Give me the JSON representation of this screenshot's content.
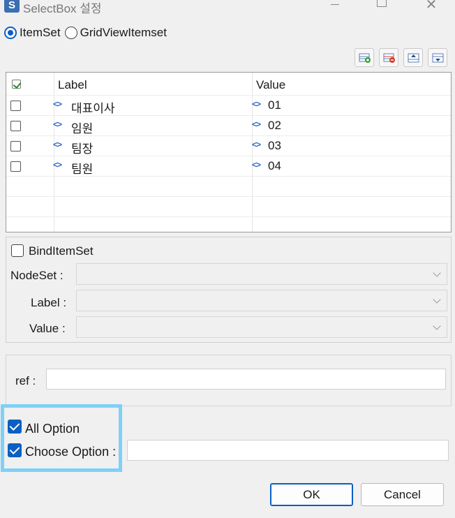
{
  "window": {
    "title": "SelectBox 설정",
    "app_icon_text": "S"
  },
  "mode": {
    "options": [
      {
        "label": "ItemSet",
        "selected": true
      },
      {
        "label": "GridViewItemset",
        "selected": false
      }
    ]
  },
  "toolbar": {
    "icons": [
      "add-row-icon",
      "delete-row-icon",
      "move-up-icon",
      "move-down-icon"
    ]
  },
  "grid": {
    "columns": {
      "label": "Label",
      "value": "Value"
    },
    "header_checked": true,
    "rows": [
      {
        "label": "대표이사",
        "value": "01",
        "checked": false
      },
      {
        "label": "임원",
        "value": "02",
        "checked": false
      },
      {
        "label": "팀장",
        "value": "03",
        "checked": false
      },
      {
        "label": "팀원",
        "value": "04",
        "checked": false
      }
    ],
    "tag_glyph": "<>"
  },
  "bind": {
    "checkbox_label": "BindItemSet",
    "checked": false,
    "nodeset_label": "NodeSet :",
    "label_label": "Label :",
    "value_label": "Value :"
  },
  "ref": {
    "label": "ref :",
    "value": ""
  },
  "options": {
    "all_option_label": "All Option",
    "all_option_checked": true,
    "choose_option_label": "Choose Option :",
    "choose_option_checked": true,
    "choose_option_value": ""
  },
  "buttons": {
    "ok": "OK",
    "cancel": "Cancel"
  },
  "colors": {
    "accent": "#0b5fc4",
    "highlight": "#7fd0f7",
    "grid_tag": "#2a66c8"
  }
}
